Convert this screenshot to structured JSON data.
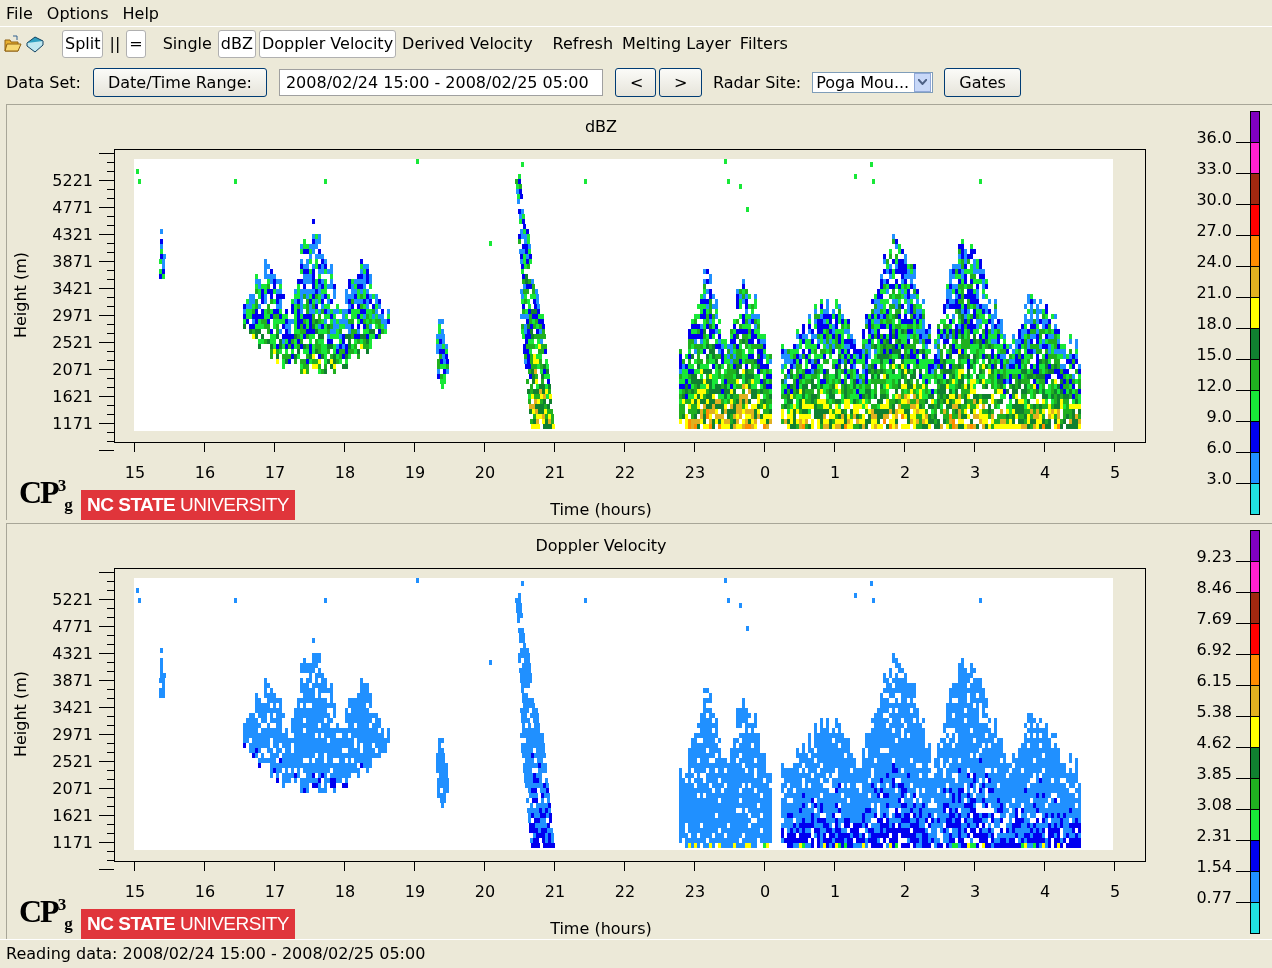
{
  "menu": [
    "File",
    "Options",
    "Help"
  ],
  "toolbar": {
    "groups": [
      [
        {
          "label": "Split",
          "selected": true
        },
        {
          "label": "||",
          "selected": false
        },
        {
          "label": "=",
          "selected": true
        }
      ],
      [
        {
          "label": "Single",
          "selected": false
        },
        {
          "label": "dBZ",
          "selected": true
        },
        {
          "label": "Doppler Velocity",
          "selected": true
        },
        {
          "label": "Derived Velocity",
          "selected": false
        }
      ],
      [
        {
          "label": "Refresh",
          "selected": false
        },
        {
          "label": "Melting Layer",
          "selected": false
        },
        {
          "label": "Filters",
          "selected": false
        }
      ]
    ]
  },
  "data_set": {
    "label": "Data Set:",
    "range_button": "Date/Time Range:",
    "range_value": "2008/02/24 15:00 - 2008/02/25 05:00",
    "prev_button": "<",
    "next_button": ">",
    "site_label": "Radar Site:",
    "site_value": "Poga Mou...",
    "gates_button": "Gates"
  },
  "plots": [
    {
      "kind": "reflectivity",
      "title": "dBZ",
      "ylabel": "Height (m)",
      "xlabel": "Time (hours)",
      "yticks": [
        "5221",
        "4771",
        "4321",
        "3871",
        "3421",
        "2971",
        "2521",
        "2071",
        "1621",
        "1171"
      ],
      "xticks": [
        "15",
        "16",
        "17",
        "18",
        "19",
        "20",
        "21",
        "22",
        "23",
        "0",
        "1",
        "2",
        "3",
        "4",
        "5"
      ],
      "logo": "CP$^{3}$$_{g}$",
      "university": "**NC STATE** UNIVERSITY",
      "colorbar": {
        "labels": [
          "36.0",
          "33.0",
          "30.0",
          "27.0",
          "24.0",
          "21.0",
          "18.0",
          "15.0",
          "12.0",
          "9.0",
          "6.0",
          "3.0"
        ],
        "segments": [
          {
            "color": "#8000c0"
          },
          {
            "color": "#ff20d0"
          },
          {
            "color": "#a02810"
          },
          {
            "color": "#ff0000"
          },
          {
            "color": "#ff8c00"
          },
          {
            "color": "#e0b020"
          },
          {
            "color": "#ffff00"
          },
          {
            "color": "#108030"
          },
          {
            "color": "#20b020"
          },
          {
            "color": "#18e838"
          },
          {
            "color": "#0000f0"
          },
          {
            "color": "#2090ff"
          },
          {
            "color": "#20e0e0"
          }
        ]
      }
    },
    {
      "kind": "velocity",
      "title": "Doppler Velocity",
      "ylabel": "Height (m)",
      "xlabel": "Time (hours)",
      "yticks": [
        "5221",
        "4771",
        "4321",
        "3871",
        "3421",
        "2971",
        "2521",
        "2071",
        "1621",
        "1171"
      ],
      "xticks": [
        "15",
        "16",
        "17",
        "18",
        "19",
        "20",
        "21",
        "22",
        "23",
        "0",
        "1",
        "2",
        "3",
        "4",
        "5"
      ],
      "logo": "CP$^{3}$$_{g}$",
      "university": "**NC STATE** UNIVERSITY",
      "colorbar": {
        "labels": [
          "9.23",
          "8.46",
          "7.69",
          "6.92",
          "6.15",
          "5.38",
          "4.62",
          "3.85",
          "3.08",
          "2.31",
          "1.54",
          "0.77"
        ],
        "segments": [
          {
            "color": "#8000c0"
          },
          {
            "color": "#ff20d0"
          },
          {
            "color": "#a02810"
          },
          {
            "color": "#ff0000"
          },
          {
            "color": "#ff8c00"
          },
          {
            "color": "#e0b020"
          },
          {
            "color": "#ffff00"
          },
          {
            "color": "#108030"
          },
          {
            "color": "#20b020"
          },
          {
            "color": "#18e838"
          },
          {
            "color": "#0000f0"
          },
          {
            "color": "#2090ff"
          },
          {
            "color": "#20e0e0"
          }
        ]
      }
    }
  ],
  "status_bar": "Reading data: 2008/02/24 15:00 - 2008/02/25 05:00"
}
